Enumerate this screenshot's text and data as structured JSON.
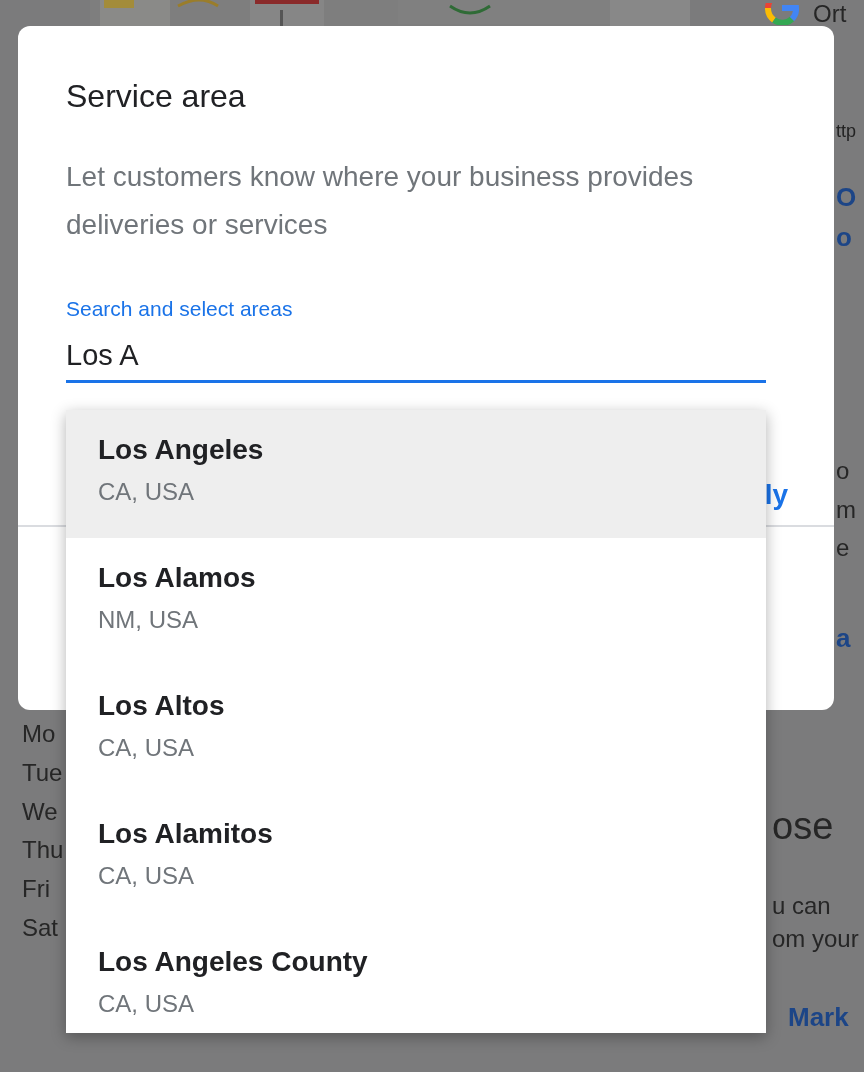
{
  "background": {
    "left_texts": [
      "Mo",
      "Tue",
      "We",
      "Thu",
      "Fri",
      "Sat"
    ],
    "right_texts": [
      {
        "text": "Ort",
        "kind": "text"
      },
      {
        "text": "ttp",
        "kind": "small"
      },
      {
        "text": "O",
        "kind": "link"
      },
      {
        "text": "o",
        "kind": "link"
      },
      {
        "text": "o",
        "kind": "text"
      },
      {
        "text": "m",
        "kind": "text"
      },
      {
        "text": "e",
        "kind": "text"
      },
      {
        "text": "a",
        "kind": "link"
      },
      {
        "text": "ose",
        "kind": "heading"
      },
      {
        "text": "u can",
        "kind": "text"
      },
      {
        "text": "om your",
        "kind": "text"
      },
      {
        "text": "Mark",
        "kind": "link"
      }
    ]
  },
  "dialog": {
    "title": "Service area",
    "description": "Let customers know where your business provides deliveries or services",
    "search": {
      "label": "Search and select areas",
      "value": "Los A"
    },
    "link_fragment": "ly",
    "suggestions": [
      {
        "name": "Los Angeles",
        "region": "CA, USA",
        "selected": true
      },
      {
        "name": "Los Alamos",
        "region": "NM, USA",
        "selected": false
      },
      {
        "name": "Los Altos",
        "region": "CA, USA",
        "selected": false
      },
      {
        "name": "Los Alamitos",
        "region": "CA, USA",
        "selected": false
      },
      {
        "name": "Los Angeles County",
        "region": "CA, USA",
        "selected": false
      }
    ]
  }
}
